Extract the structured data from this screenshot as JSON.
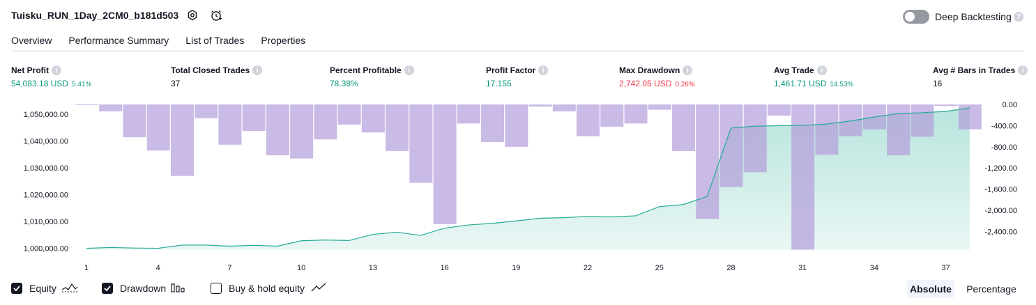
{
  "header": {
    "strategy_name": "Tuisku_RUN_1Day_2CM0_b181d503",
    "deep_backtesting_label": "Deep Backtesting",
    "deep_backtesting_enabled": false
  },
  "tabs": [
    {
      "label": "Overview",
      "active": true
    },
    {
      "label": "Performance Summary",
      "active": false
    },
    {
      "label": "List of Trades",
      "active": false
    },
    {
      "label": "Properties",
      "active": false
    }
  ],
  "metrics": {
    "net_profit": {
      "label": "Net Profit",
      "value": "54,083.18 USD",
      "pct": "5.41%"
    },
    "total_closed_trades": {
      "label": "Total Closed Trades",
      "value": "37"
    },
    "percent_profitable": {
      "label": "Percent Profitable",
      "value": "78.38%"
    },
    "profit_factor": {
      "label": "Profit Factor",
      "value": "17.155"
    },
    "max_drawdown": {
      "label": "Max Drawdown",
      "value": "2,742.05 USD",
      "pct": "0.26%"
    },
    "avg_trade": {
      "label": "Avg Trade",
      "value": "1,461.71 USD",
      "pct": "14.53%"
    },
    "avg_bars": {
      "label": "Avg # Bars in Trades",
      "value": "16"
    }
  },
  "chart_data": {
    "type": "line",
    "x": [
      1,
      2,
      3,
      4,
      5,
      6,
      7,
      8,
      9,
      10,
      11,
      12,
      13,
      14,
      15,
      16,
      17,
      18,
      19,
      20,
      21,
      22,
      23,
      24,
      25,
      26,
      27,
      28,
      29,
      30,
      31,
      32,
      33,
      34,
      35,
      36,
      37,
      38
    ],
    "x_tick_labels": [
      "1",
      "4",
      "7",
      "10",
      "13",
      "16",
      "19",
      "22",
      "25",
      "28",
      "31",
      "34",
      "37"
    ],
    "left_axis_ticks": [
      "1,050,000.00",
      "1,040,000.00",
      "1,030,000.00",
      "1,020,000.00",
      "1,010,000.00",
      "1,000,000.00"
    ],
    "right_axis_ticks": [
      "0.00",
      "-400.00",
      "-800.00",
      "-1,200.00",
      "-1,600.00",
      "-2,000.00",
      "-2,400.00"
    ],
    "ylim_equity": [
      999500,
      1053600
    ],
    "ylim_drawdown": [
      -2742,
      0
    ],
    "series": [
      {
        "name": "Equity",
        "axis": "left",
        "color": "#22ab94",
        "values": [
          1000000,
          1000300,
          1000100,
          1000000,
          1001200,
          1001200,
          1000800,
          1001100,
          1000800,
          1002800,
          1003100,
          1002900,
          1005200,
          1006000,
          1004800,
          1007500,
          1008700,
          1009300,
          1010200,
          1011200,
          1011400,
          1011900,
          1011700,
          1012100,
          1015500,
          1016300,
          1019300,
          1044800,
          1045500,
          1045700,
          1045800,
          1046300,
          1047400,
          1048900,
          1050200,
          1050500,
          1051000,
          1052300
        ]
      },
      {
        "name": "Drawdown",
        "axis": "right",
        "color": "#b39ddb",
        "values": [
          -10,
          -130,
          -620,
          -870,
          -1350,
          -260,
          -760,
          -500,
          -960,
          -1020,
          -660,
          -380,
          -530,
          -880,
          -1480,
          -2260,
          -360,
          -710,
          -800,
          -40,
          -130,
          -600,
          -420,
          -360,
          -100,
          -880,
          -2160,
          -1560,
          -1280,
          -210,
          -2742,
          -950,
          -600,
          -470,
          -960,
          -610,
          -30,
          -470
        ]
      }
    ]
  },
  "footer": {
    "equity_label": "Equity",
    "equity_checked": true,
    "drawdown_label": "Drawdown",
    "drawdown_checked": true,
    "buy_hold_label": "Buy & hold equity",
    "buy_hold_checked": false,
    "absolute_label": "Absolute",
    "percentage_label": "Percentage",
    "selected_scale": "Absolute"
  }
}
